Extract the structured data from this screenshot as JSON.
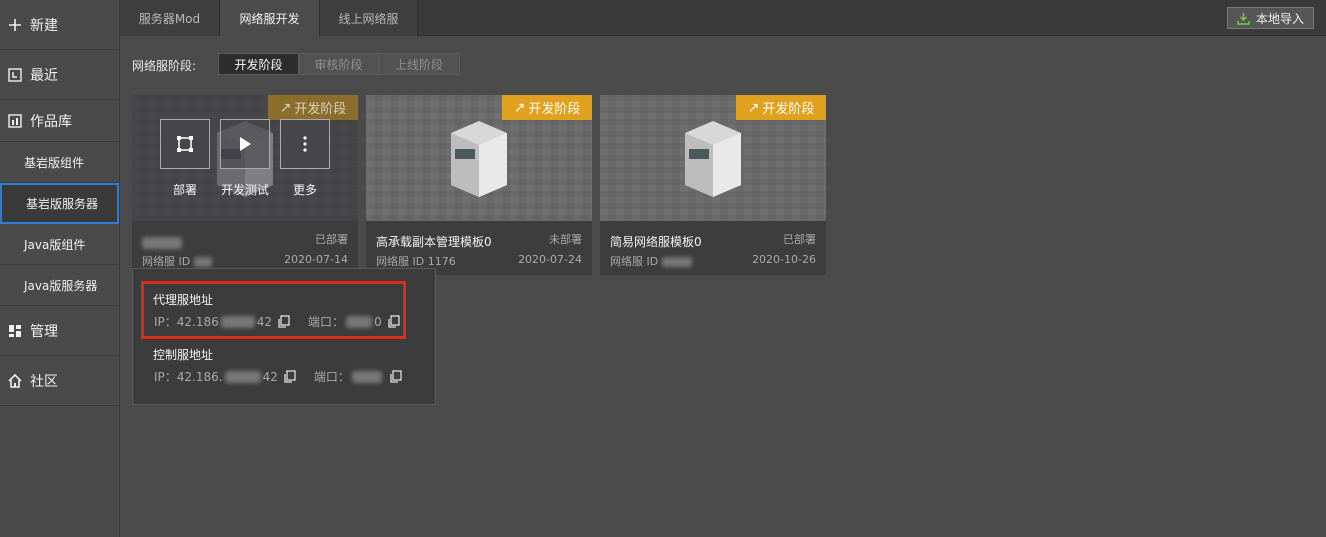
{
  "sidebar": {
    "new": "新建",
    "recent": "最近",
    "library": "作品库",
    "bedrock_component": "基岩版组件",
    "bedrock_server": "基岩版服务器",
    "java_component": "Java版组件",
    "java_server": "Java版服务器",
    "manage": "管理",
    "community": "社区"
  },
  "tabs": [
    "服务器Mod",
    "网络服开发",
    "线上网络服"
  ],
  "import_label": "本地导入",
  "stage": {
    "label": "网络服阶段:",
    "options": [
      "开发阶段",
      "审核阶段",
      "上线阶段"
    ],
    "selected": "开发阶段"
  },
  "cards": [
    {
      "badge": "开发阶段",
      "name": "",
      "status": "已部署",
      "id_label": "网络服 ID",
      "id_value": "",
      "date": "2020-07-14",
      "actions": [
        "部署",
        "开发测试",
        "更多"
      ]
    },
    {
      "badge": "开发阶段",
      "name": "高承载副本管理模板0",
      "status": "未部署",
      "id_label": "网络服 ID",
      "id_value": "1176",
      "date": "2020-07-24"
    },
    {
      "badge": "开发阶段",
      "name": "简易网络服模板0",
      "status": "已部署",
      "id_label": "网络服 ID",
      "id_value": "",
      "date": "2020-10-26"
    }
  ],
  "popup": {
    "proxy_title": "代理服地址",
    "proxy_ip_prefix": "IP：42.186",
    "proxy_ip_suffix": "42",
    "proxy_port_label": "端口：",
    "proxy_port_suffix": "0",
    "control_title": "控制服地址",
    "control_ip_prefix": "IP：42.186.",
    "control_ip_suffix": "42",
    "control_port_label": "端口："
  },
  "colors": {
    "badge": "#e0a11e",
    "highlight_box": "#d92e1c",
    "active_nav_border": "#2d7fd3"
  }
}
